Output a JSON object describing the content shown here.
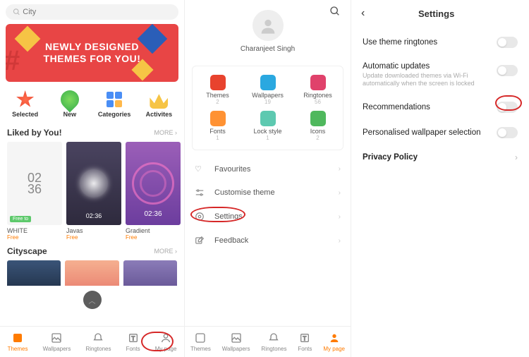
{
  "panel1": {
    "search_placeholder": "City",
    "banner_line1": "NEWLY DESIGNED",
    "banner_line2": "THEMES FOR YOU!",
    "quick": [
      {
        "label": "Selected"
      },
      {
        "label": "New"
      },
      {
        "label": "Categories"
      },
      {
        "label": "Activites"
      }
    ],
    "liked_title": "Liked by You!",
    "more_label": "MORE",
    "liked": [
      {
        "name": "WHITE",
        "price": "Free",
        "clock": "02\n36",
        "badge": "Free to"
      },
      {
        "name": "Javas",
        "price": "Free",
        "clock": "02:36"
      },
      {
        "name": "Gradient",
        "price": "Free",
        "clock": "02:36"
      }
    ],
    "city_title": "Cityscape",
    "nav": [
      {
        "label": "Themes"
      },
      {
        "label": "Wallpapers"
      },
      {
        "label": "Ringtones"
      },
      {
        "label": "Fonts"
      },
      {
        "label": "My page"
      }
    ]
  },
  "panel2": {
    "username": "Charanjeet Singh",
    "grid": [
      {
        "label": "Themes",
        "count": "2",
        "color": "#e8432e"
      },
      {
        "label": "Wallpapers",
        "count": "19",
        "color": "#2aa8e0"
      },
      {
        "label": "Ringtones",
        "count": "56",
        "color": "#e0426b"
      },
      {
        "label": "Fonts",
        "count": "1",
        "color": "#ff9233"
      },
      {
        "label": "Lock style",
        "count": "1",
        "color": "#5dc9b0"
      },
      {
        "label": "Icons",
        "count": "2",
        "color": "#4fb85d"
      }
    ],
    "menu": [
      {
        "label": "Favourites"
      },
      {
        "label": "Customise theme"
      },
      {
        "label": "Settings"
      },
      {
        "label": "Feedback"
      }
    ],
    "nav": [
      {
        "label": "Themes"
      },
      {
        "label": "Wallpapers"
      },
      {
        "label": "Ringtones"
      },
      {
        "label": "Fonts"
      },
      {
        "label": "My page"
      }
    ]
  },
  "panel3": {
    "title": "Settings",
    "rows": [
      {
        "label": "Use theme ringtones",
        "type": "toggle"
      },
      {
        "label": "Automatic updates",
        "sub": "Update downloaded themes via Wi-Fi automatically when the screen is locked",
        "type": "toggle"
      },
      {
        "label": "Recommendations",
        "type": "toggle"
      },
      {
        "label": "Personalised wallpaper selection",
        "type": "toggle"
      },
      {
        "label": "Privacy Policy",
        "type": "chevron"
      }
    ]
  }
}
